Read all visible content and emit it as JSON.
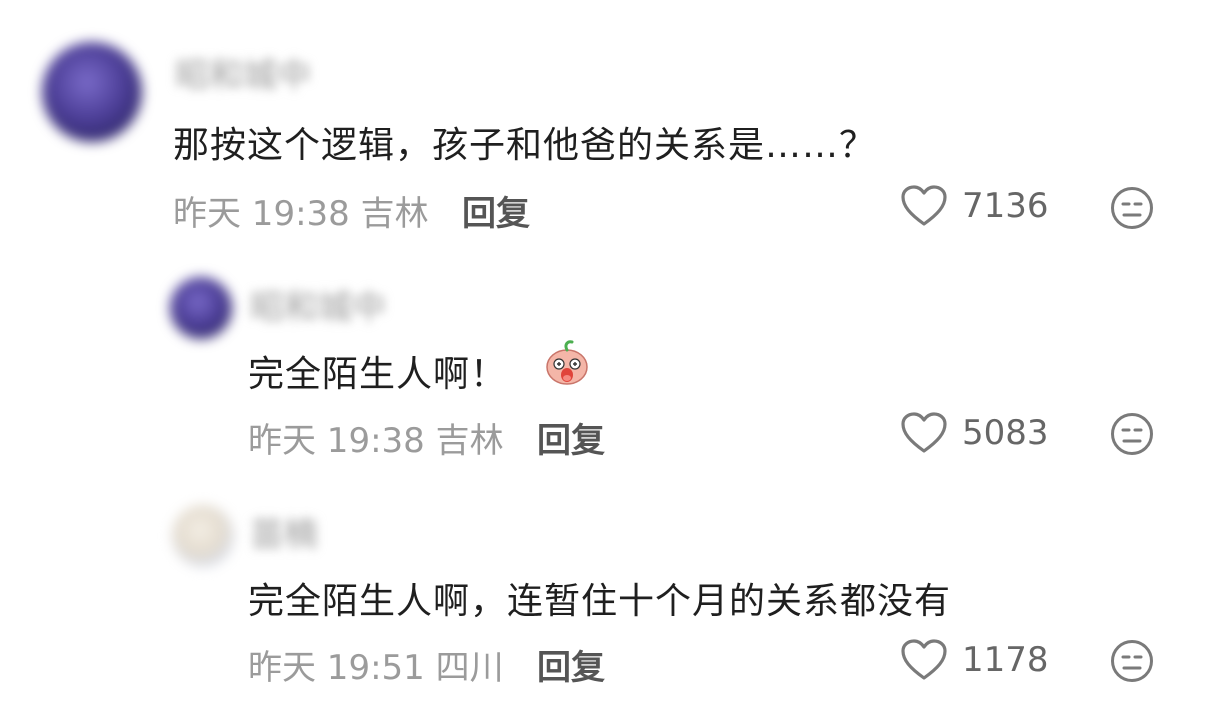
{
  "comments": [
    {
      "username": "昭和城中",
      "text": "那按这个逻辑，孩子和他爸的关系是……？",
      "time": "昨天 19:38",
      "location": "吉林",
      "reply_label": "回复",
      "likes": "7136"
    },
    {
      "username": "昭和城中",
      "text": "完全陌生人啊！",
      "emoji": "surprised-sticker",
      "time": "昨天 19:38",
      "location": "吉林",
      "reply_label": "回复",
      "likes": "5083"
    },
    {
      "username": "苗楠",
      "text": "完全陌生人啊，连暂住十个月的关系都没有",
      "time": "昨天 19:51",
      "location": "四川",
      "reply_label": "回复",
      "likes": "1178"
    }
  ],
  "icons": {
    "like": "heart-outline-icon",
    "dislike": "neutral-face-icon"
  },
  "colors": {
    "text": "#1f1f1f",
    "meta": "#9b9b9b",
    "reply": "#555555"
  }
}
